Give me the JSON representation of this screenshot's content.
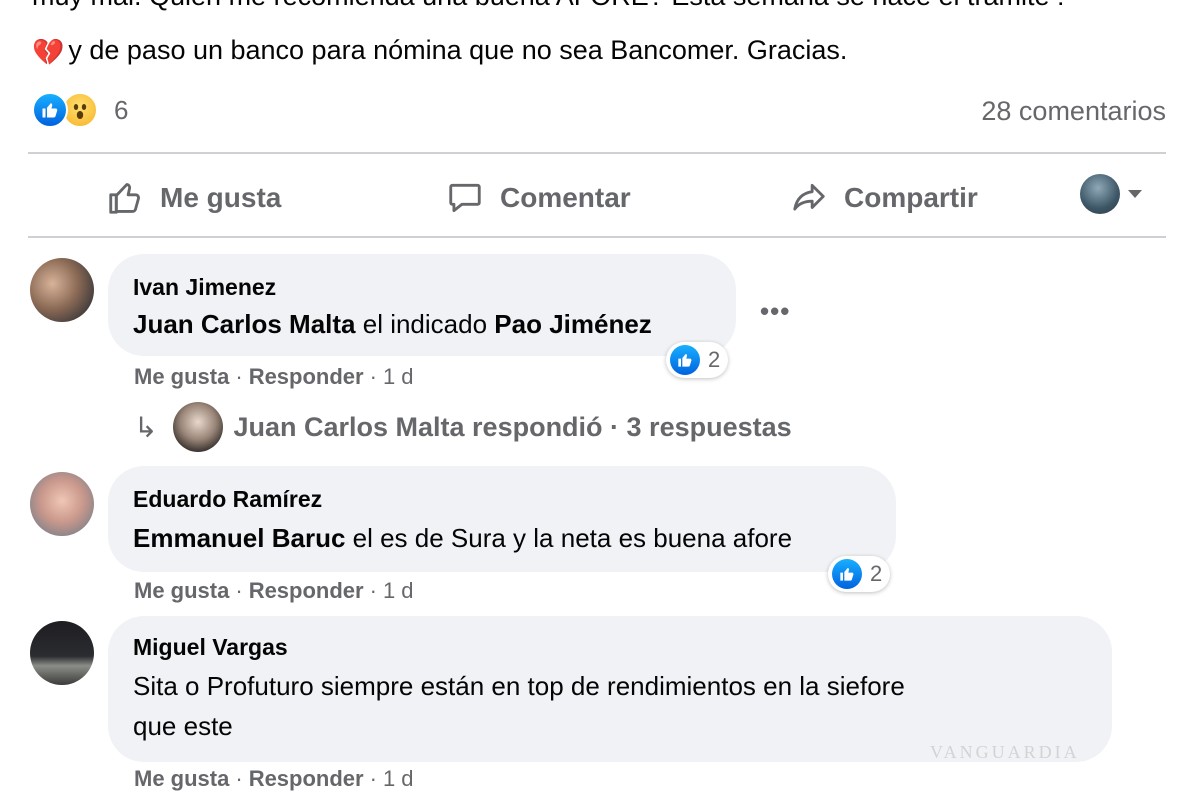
{
  "post": {
    "text_line1": "muy mal. Quien me recomienda una buena AFORE? Esta semana se hace el tramite !",
    "text_line2": "y de paso un banco para nómina que no sea Bancomer. Gracias.",
    "heart_emoji": "💔",
    "reaction_count": "6",
    "comments_label": "28 comentarios"
  },
  "actions": {
    "like": "Me gusta",
    "comment": "Comentar",
    "share": "Compartir"
  },
  "comments": [
    {
      "author": "Ivan Jimenez",
      "mention1": "Juan Carlos Malta",
      "text": " el indicado ",
      "mention2": "Pao Jiménez",
      "like": "Me gusta",
      "reply": "Responder",
      "time": "1 d",
      "reaction_count": "2",
      "replies": {
        "label": "Juan Carlos Malta respondió · 3 respuestas"
      }
    },
    {
      "author": "Eduardo Ramírez",
      "mention1": "Emmanuel Baruc",
      "text": " el es de Sura y la neta es buena afore",
      "like": "Me gusta",
      "reply": "Responder",
      "time": "1 d",
      "reaction_count": "2"
    },
    {
      "author": "Miguel Vargas",
      "text_line1": "Sita o Profuturo siempre están en top de rendimientos en la siefore",
      "text_line2": "que este",
      "like": "Me gusta",
      "reply": "Responder",
      "time": "1 d"
    }
  ],
  "watermark": "VANGUARDIA",
  "colors": {
    "accent": "#1877f2",
    "secondary_text": "#65676b",
    "bubble_bg": "#f0f2f5",
    "divider": "#ced0d4"
  },
  "icons": [
    "like-icon",
    "wow-icon",
    "thumb-up-outline-icon",
    "comment-icon",
    "share-icon",
    "chevron-down-icon",
    "more-icon",
    "reply-arrow-icon"
  ]
}
